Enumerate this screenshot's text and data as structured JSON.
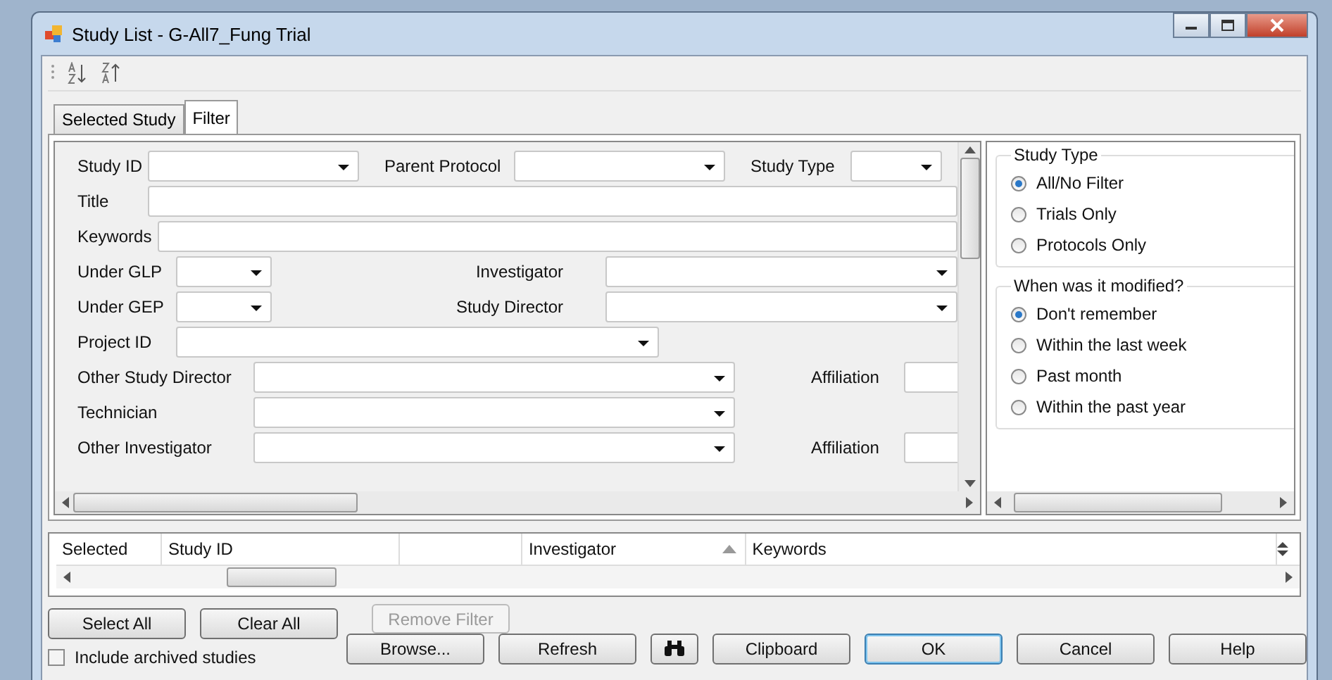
{
  "window": {
    "title": "Study List - G-All7_Fung Trial"
  },
  "tabs": [
    {
      "label": "Selected Study",
      "selected": false
    },
    {
      "label": "Filter",
      "selected": true
    }
  ],
  "filter_form": {
    "rows": [
      [
        {
          "label": "Study ID",
          "kind": "combo"
        },
        {
          "label": "Parent Protocol",
          "kind": "combo"
        },
        {
          "label": "Study Type",
          "kind": "combo"
        }
      ],
      [
        {
          "label": "Title",
          "kind": "text"
        }
      ],
      [
        {
          "label": "Keywords",
          "kind": "text"
        }
      ],
      [
        {
          "label": "Under GLP",
          "kind": "combo"
        },
        {
          "label": "Investigator",
          "kind": "combo"
        }
      ],
      [
        {
          "label": "Under GEP",
          "kind": "combo"
        },
        {
          "label": "Study Director",
          "kind": "combo"
        }
      ],
      [
        {
          "label": "Project ID",
          "kind": "combo"
        }
      ],
      [
        {
          "label": "Other Study Director",
          "kind": "combo"
        },
        {
          "label": "Affiliation",
          "kind": "text"
        }
      ],
      [
        {
          "label": "Technician",
          "kind": "combo"
        }
      ],
      [
        {
          "label": "Other Investigator",
          "kind": "combo"
        },
        {
          "label": "Affiliation",
          "kind": "text"
        }
      ]
    ]
  },
  "radio_groups": [
    {
      "title": "Study Type",
      "options": [
        {
          "label": "All/No Filter",
          "selected": true
        },
        {
          "label": "Trials Only",
          "selected": false
        },
        {
          "label": "Protocols Only",
          "selected": false
        }
      ]
    },
    {
      "title": "When was it modified?",
      "options": [
        {
          "label": "Don't remember",
          "selected": true
        },
        {
          "label": "Within the last week",
          "selected": false
        },
        {
          "label": "Past month",
          "selected": false
        },
        {
          "label": "Within the past year",
          "selected": false
        }
      ]
    }
  ],
  "grid": {
    "columns": [
      {
        "label": "Selected",
        "sorted": false
      },
      {
        "label": "Study ID",
        "sorted": false
      },
      {
        "sorted": false
      },
      {
        "label": "Investigator",
        "sorted": true
      },
      {
        "label": "Keywords",
        "sorted": false
      }
    ]
  },
  "buttons_left": [
    {
      "label": "Select All",
      "disabled": false
    },
    {
      "label": "Clear All",
      "disabled": false
    },
    {
      "label": "Remove Filter",
      "disabled": true
    }
  ],
  "archived_checkbox": {
    "label": "Include archived studies",
    "checked": false
  },
  "buttons_right": [
    {
      "kind": "text",
      "label": "Browse...",
      "default": false
    },
    {
      "kind": "text",
      "label": "Refresh",
      "default": false
    },
    {
      "kind": "icon",
      "default": false
    },
    {
      "kind": "text",
      "label": "Clipboard",
      "default": false
    },
    {
      "kind": "text",
      "label": "OK",
      "default": true
    },
    {
      "kind": "text",
      "label": "Cancel",
      "default": false
    },
    {
      "kind": "text",
      "label": "Help",
      "default": false
    }
  ]
}
